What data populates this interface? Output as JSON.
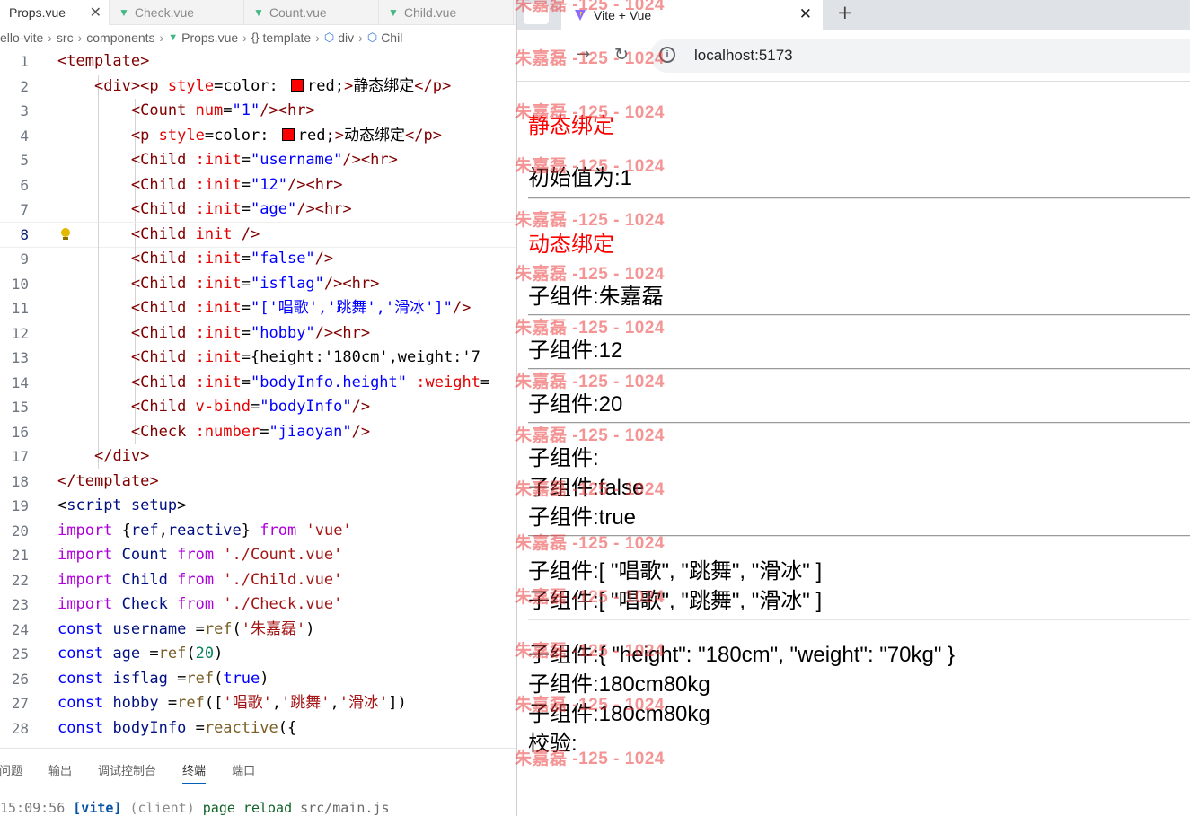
{
  "editor": {
    "tabs": [
      {
        "label": "Props.vue",
        "active": true
      },
      {
        "label": "Check.vue",
        "active": false
      },
      {
        "label": "Count.vue",
        "active": false
      },
      {
        "label": "Child.vue",
        "active": false
      }
    ],
    "breadcrumb": [
      "ello-vite",
      "src",
      "components",
      "Props.vue",
      "template",
      "div",
      "Chil"
    ],
    "current_line": 8,
    "code": [
      [
        "<template>"
      ],
      [
        "    <div><p style=\"color: ",
        "red;\">静态绑定</p>"
      ],
      [
        "        <Count num=\"1\"/><hr>"
      ],
      [
        "        <p style=\"color: ",
        "red;\">动态绑定</p>"
      ],
      [
        "        <Child :init=\"username\"/><hr>"
      ],
      [
        "        <Child :init=\"12\"/><hr>"
      ],
      [
        "        <Child :init=\"age\"/><hr>"
      ],
      [
        "        <Child init />"
      ],
      [
        "        <Child :init=\"false\"/>"
      ],
      [
        "        <Child :init=\"isflag\"/><hr>"
      ],
      [
        "        <Child :init=\"['唱歌','跳舞','滑冰']\"/>"
      ],
      [
        "        <Child :init=\"hobby\"/><hr>"
      ],
      [
        "        <Child :init=\"{height:'180cm',weight:'7"
      ],
      [
        "        <Child :init=\"bodyInfo.height\" :weight="
      ],
      [
        "        <Child v-bind=\"bodyInfo\"/>"
      ],
      [
        "        <Check :number=\"jiaoyan\"/>"
      ],
      [
        "    </div>"
      ],
      [
        "</template>"
      ],
      [
        "<script setup>"
      ],
      [
        "import {ref,reactive} from 'vue'"
      ],
      [
        "import Count from './Count.vue'"
      ],
      [
        "import Child from './Child.vue'"
      ],
      [
        "import Check from './Check.vue'"
      ],
      [
        "const username =ref('朱嘉磊')"
      ],
      [
        "const age =ref(20)"
      ],
      [
        "const isflag =ref(true)"
      ],
      [
        "const hobby =ref(['唱歌','跳舞','滑冰'])"
      ],
      [
        "const bodyInfo =reactive({"
      ]
    ],
    "panel_tabs": [
      "问题",
      "输出",
      "调试控制台",
      "终端",
      "端口"
    ],
    "active_panel_tab": "终端",
    "terminal": {
      "time": "15:09:56",
      "tag": "[vite]",
      "source": "(client)",
      "message": "page reload",
      "path": "src/main.js"
    }
  },
  "browser": {
    "tab_title": "Vite + Vue",
    "url": "localhost:5173",
    "output": {
      "static_label": "静态绑定",
      "count_text": "初始值为:1",
      "dynamic_label": "动态绑定",
      "child_username": "子组件:朱嘉磊",
      "child_12": "子组件:12",
      "child_age": "子组件:20",
      "child_init": "子组件:",
      "child_false": "子组件:false",
      "child_true": "子组件:true",
      "child_array1": "子组件:[ \"唱歌\", \"跳舞\", \"滑冰\" ]",
      "child_array2": "子组件:[ \"唱歌\", \"跳舞\", \"滑冰\" ]",
      "child_object": "子组件:{ \"height\": \"180cm\", \"weight\": \"70kg\" }",
      "child_body1": "子组件:180cm80kg",
      "child_body2": "子组件:180cm80kg",
      "check_text": "校验:"
    }
  },
  "watermark": {
    "text": "朱嘉磊 -125 - 1024",
    "color": "#eb3c3c"
  },
  "colors": {
    "tag": "#800000",
    "attribute": "#e50000",
    "string": "#0000ff",
    "keyword": "#af00db",
    "vue_green": "#41b883",
    "static_text": "#ff0000"
  }
}
